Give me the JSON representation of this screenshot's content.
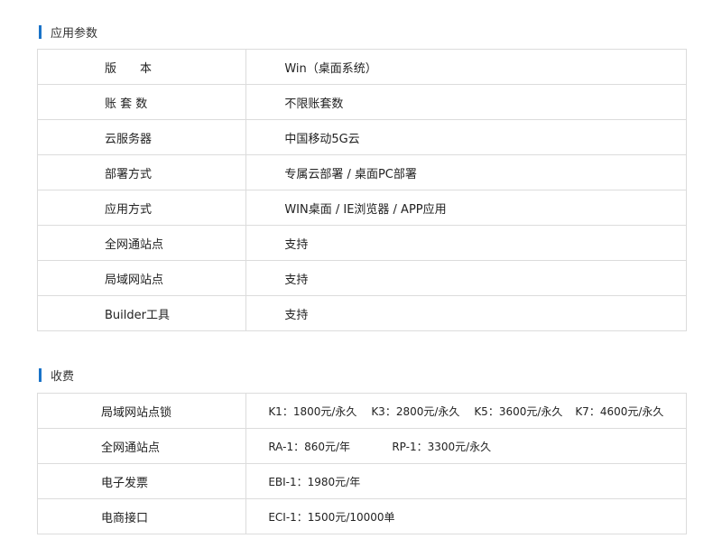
{
  "section1": {
    "title": "应用参数",
    "rows": [
      {
        "label": "版　　本",
        "value": "Win（桌面系统）"
      },
      {
        "label": "账 套 数",
        "value": "不限账套数"
      },
      {
        "label": "云服务器",
        "value": "中国移动5G云"
      },
      {
        "label": "部署方式",
        "value": "专属云部署 / 桌面PC部署"
      },
      {
        "label": "应用方式",
        "value": "WIN桌面 / IE浏览器 / APP应用"
      },
      {
        "label": "全网通站点",
        "value": "支持"
      },
      {
        "label": "局域网站点",
        "value": "支持"
      },
      {
        "label": "Builder工具",
        "value": "支持"
      }
    ]
  },
  "section2": {
    "title": "收费",
    "rows": [
      {
        "label": "局域网站点锁",
        "prices": [
          "K1：1800元/永久",
          "K3：2800元/永久",
          "K5：3600元/永久",
          "K7：4600元/永久"
        ]
      },
      {
        "label": "全网通站点",
        "prices": [
          "RA-1：860元/年",
          "RP-1：3300元/永久"
        ]
      },
      {
        "label": "电子发票",
        "prices": [
          "EBI-1：1980元/年"
        ]
      },
      {
        "label": "电商接口",
        "prices": [
          "ECI-1：1500元/10000单"
        ]
      }
    ]
  }
}
